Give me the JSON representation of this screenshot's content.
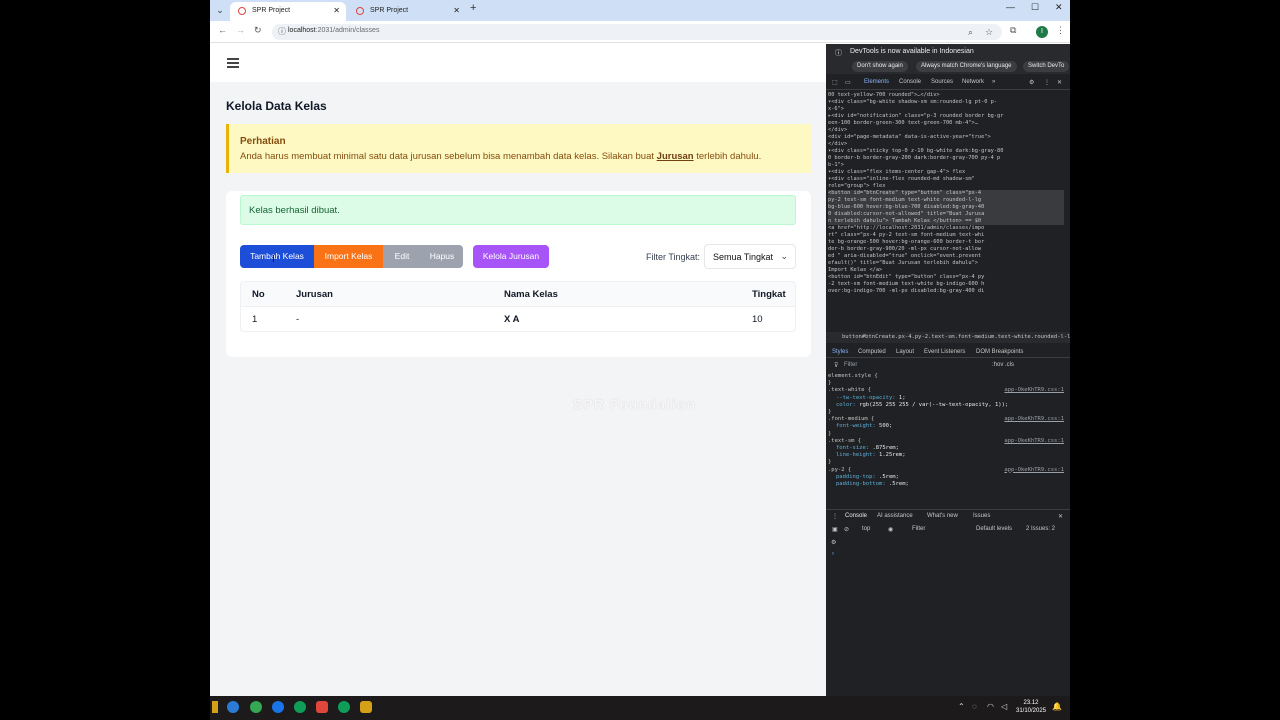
{
  "browser": {
    "tabs": [
      {
        "title": "SPR Project",
        "active": true
      },
      {
        "title": "SPR Project",
        "active": false
      }
    ],
    "url_host": "localhost",
    "url_path": ":2031/admin/classes",
    "profile_initial": "I"
  },
  "page": {
    "title": "Kelola Data Kelas",
    "alert": {
      "title": "Perhatian",
      "message_before": "Anda harus membuat minimal satu data jurusan sebelum bisa menambah data kelas. Silakan buat ",
      "link": "Jurusan",
      "message_after": " terlebih dahulu."
    },
    "success_message": "Kelas berhasil dibuat.",
    "buttons": {
      "add": "Tambah Kelas",
      "import": "Import Kelas",
      "edit": "Edit",
      "delete": "Hapus",
      "manage_jurusan": "Kelola Jurusan"
    },
    "filter": {
      "label": "Filter Tingkat:",
      "selected": "Semua Tingkat"
    },
    "table": {
      "headers": [
        "No",
        "Jurusan",
        "Nama Kelas",
        "Tingkat"
      ],
      "rows": [
        [
          "1",
          "-",
          "X A",
          "10"
        ]
      ]
    },
    "watermark": "SPR Foundation"
  },
  "devtools": {
    "banner": "DevTools is now available in Indonesian",
    "banner_buttons": [
      "Don't show again",
      "Always match Chrome's language",
      "Switch DevTo"
    ],
    "tabs": [
      "Elements",
      "Console",
      "Sources",
      "Network"
    ],
    "code_lines": [
      "00 text-yellow-700 rounded\">…</div>",
      "▾<div class=\"bg-white shadow-sm sm:rounded-lg pt-0 p-",
      "  x-6\">",
      "  ▸<div id=\"notification\" class=\"p-3 rounded border bg-gr",
      "   een-100 border-green-300 text-green-700 mb-4\">…",
      "   </div>",
      "   <div id=\"page-metadata\" data-is-active-year=\"true\">",
      "   </div>",
      "  ▾<div class=\"sticky top-0 z-10 bg-white dark:bg-gray-80",
      "   0 border-b border-gray-200 dark:border-gray-700 py-4 p",
      "   b-1\">",
      "   ▾<div class=\"flex items-center gap-4\"> flex",
      "    ▾<div class=\"inline-flex rounded-md shadow-sm\"",
      "      role=\"group\"> flex",
      "      <button id=\"btnCreate\" type=\"button\" class=\"px-4",
      "       py-2 text-sm font-medium text-white rounded-l-lg",
      "       bg-blue-600 hover:bg-blue-700 disabled:bg-gray-40",
      "       0 disabled:cursor-not-allowed\" title=\"Buat Jurusa",
      "       n terlebih dahulu\"> Tambah Kelas </button> == $0",
      "      <a href=\"http://localhost:2031/admin/classes/impo",
      "       rt\" class=\"px-4 py-2 text-sm font-medium text-whi",
      "       te bg-orange-500 hover:bg-orange-600 border-t bor",
      "       der-b border-gray-900/20 -ml-px  cursor-not-allow",
      "       ed \" aria-disabled=\"true\" onclick=\"event.prevent",
      "       efault()\" title=\"Buat Jurusan terlebih dahulu\">",
      "       Import Kelas </a>",
      "      <button id=\"btnEdit\" type=\"button\" class=\"px-4 py",
      "       -2 text-sm font-medium text-white bg-indigo-600 h",
      "       over:bg-indigo-700 -ml-px disabled:bg-gray-400 di"
    ],
    "crumb": "button#btnCreate.px-4.py-2.text-sm.font-medium.text-white.rounded-l-lg.bg-blu",
    "subtabs": [
      "Styles",
      "Computed",
      "Layout",
      "Event Listeners",
      "DOM Breakpoints"
    ],
    "filter_placeholder": "Filter",
    "filter_tools": ":hov .cls",
    "styles": [
      {
        "selector": "element.style {",
        "src": ""
      },
      {
        "selector": "}",
        "src": ""
      },
      {
        "selector": ".text-white {",
        "src": "app-OkeKhTR9.css:1"
      },
      {
        "prop": "--tw-text-opacity",
        "val": "1;"
      },
      {
        "prop": "color",
        "val": "rgb(255 255 255 / var(--tw-text-opacity, 1));"
      },
      {
        "selector": "}",
        "src": ""
      },
      {
        "selector": ".font-medium {",
        "src": "app-OkeKhTR9.css:1"
      },
      {
        "prop": "font-weight",
        "val": "500;"
      },
      {
        "selector": "}",
        "src": ""
      },
      {
        "selector": ".text-sm {",
        "src": "app-OkeKhTR9.css:1"
      },
      {
        "prop": "font-size",
        "val": ".875rem;"
      },
      {
        "prop": "line-height",
        "val": "1.25rem;"
      },
      {
        "selector": "}",
        "src": ""
      },
      {
        "selector": ".py-2 {",
        "src": "app-OkeKhTR9.css:1"
      },
      {
        "prop": "padding-top",
        "val": ".5rem;"
      },
      {
        "prop": "padding-bottom",
        "val": ".5rem;"
      }
    ],
    "console_tabs": [
      "Console",
      "AI assistance",
      "What's new",
      "Issues"
    ],
    "console_context": "top",
    "console_filter": "Filter",
    "console_levels": "Default levels",
    "console_issues": "2 Issues: 2"
  },
  "taskbar": {
    "time": "23.12",
    "date": "31/10/2025"
  },
  "colors": {
    "primary": "#1d4ed8",
    "import": "#f97316",
    "disabled": "#9ca3af",
    "jurusan": "#a855f7",
    "success_bg": "#dcfce7",
    "alert_bg": "#fef9c3"
  }
}
